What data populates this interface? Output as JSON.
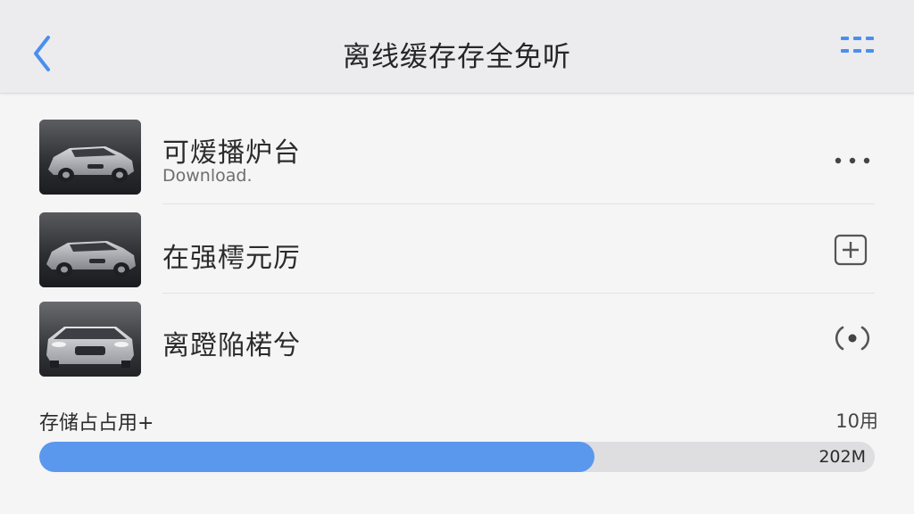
{
  "colors": {
    "accent": "#4a8ff0",
    "progress_fill": "#5a98ee",
    "progress_track": "#dedee0",
    "header_bg": "#ececee",
    "page_bg": "#f5f5f6"
  },
  "header": {
    "back_icon": "chevron-left-icon",
    "title": "离线缓存存全免听",
    "menu_icon": "grid-menu-icon"
  },
  "items": [
    {
      "thumbnail": "car-photo",
      "title": "可煖播炉台",
      "subtitle": "Download.",
      "action_icon": "more-dots-icon"
    },
    {
      "thumbnail": "car-photo",
      "title": "在强樗元厉",
      "subtitle": "",
      "action_icon": "add-square-icon"
    },
    {
      "thumbnail": "car-photo",
      "title": "离蹬陥楉兮",
      "subtitle": "",
      "action_icon": "radio-target-icon"
    }
  ],
  "storage": {
    "label": "存储占占用+",
    "total": "10用",
    "used_text": "202M",
    "used_fraction": 0.665
  }
}
